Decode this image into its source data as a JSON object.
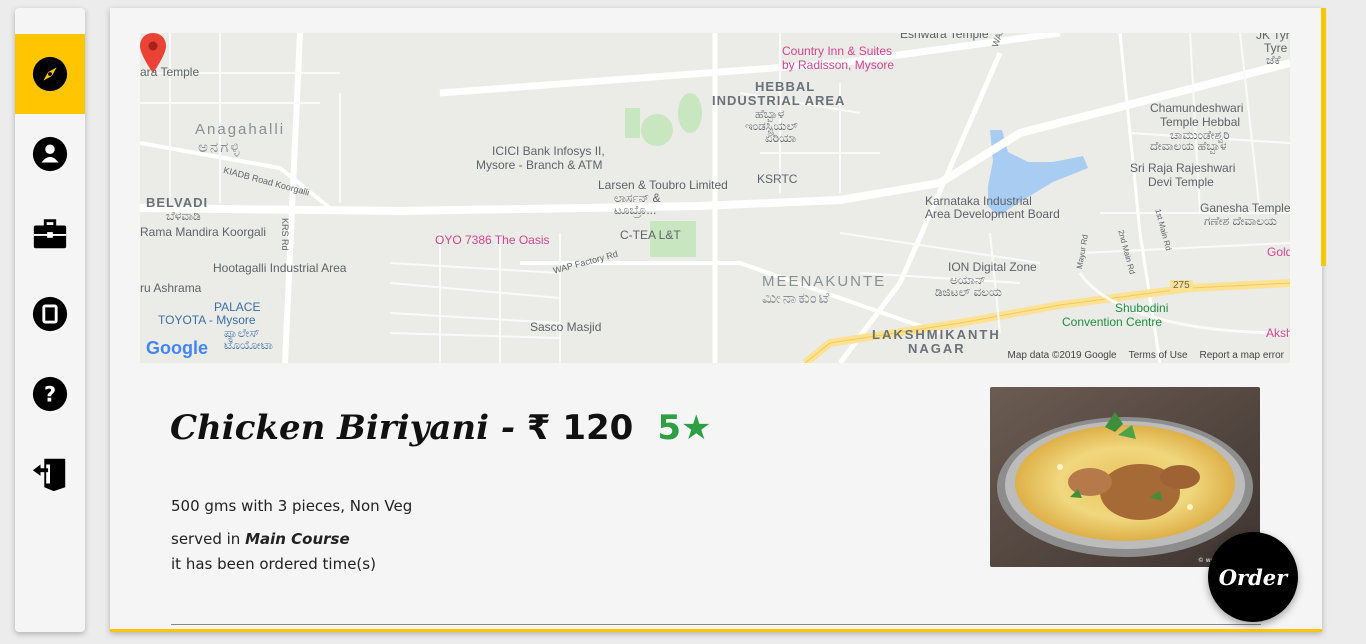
{
  "sidebar": {
    "items": [
      {
        "icon": "compass-icon",
        "active": true
      },
      {
        "icon": "user-icon",
        "active": false
      },
      {
        "icon": "briefcase-icon",
        "active": false
      },
      {
        "icon": "phone-icon",
        "active": false
      },
      {
        "icon": "help-icon",
        "active": false
      },
      {
        "icon": "exit-icon",
        "active": false
      }
    ]
  },
  "map": {
    "labels": {
      "eshwara_temple": "Eshwara Temple",
      "country_inn": "Country Inn & Suites",
      "by_radisson": "by Radisson, Mysore",
      "jk_tyre": "JK Tyre",
      "tyre": "Tyre",
      "tyre_kn": "ಜೆಕೆ",
      "ara_temple": "ara Temple",
      "hebbal": "HEBBAL",
      "industrial_area": "INDUSTRIAL AREA",
      "hebbal_kn": "ಹೆಬ್ಬಾಳ",
      "industrial_kn": "ಇಂಡಸ್ಟ್ರಿಯಲ್",
      "area_kn": "ಏರಿಯಾ",
      "wap_factory_rd": "WAP Factory Rd",
      "chamundeshwari": "Chamundeshwari",
      "temple_hebbal": "Temple Hebbal",
      "chamundeshwari_kn": "ಚಾಮುಂಡೇಶ್ವರಿ",
      "devalaya_kn": "ದೇವಾಲಯ ಹೆಬ್ಬಾಳ",
      "anagahalli": "Anagahalli",
      "anagahalli_kn": "ಅನಗಳ್ಳಿ",
      "icici": "ICICI Bank Infosys II,",
      "icici2": "Mysore - Branch & ATM",
      "sri_raja": "Sri Raja Rajeshwari",
      "devi_temple": "Devi Temple",
      "kiadb": "KIADB Road Koorgalli",
      "larsen": "Larsen & Toubro Limited",
      "larsen_kn1": "ಲಾರ್ಸನ್ &",
      "larsen_kn2": "ಟೂಬ್ರೊ...",
      "ksrtc": "KSRTC",
      "belvadi": "BELVADI",
      "belvadi_kn": "ಬೆಳವಾಡಿ",
      "karnataka_ind": "Karnataka Industrial",
      "area_dev": "Area Development Board",
      "ganesha": "Ganesha Temple",
      "ganesha_kn": "ಗಣೇಶ ದೇವಾಲಯ",
      "rama_mandira": "Rama Mandira Koorgali",
      "krs_rd": "KRS Rd",
      "c_tea": "C-TEA L&T",
      "oyo": "OYO 7386 The Oasis",
      "gold": "Gold",
      "hootagalli": "Hootagalli Industrial Area",
      "wap_factory_rd2": "WAP Factory Rd",
      "meenakunte": "MEENAKUNTE",
      "meenakunte_kn": "ಮೀನಾಕುಂಟೆ",
      "ion": "ION Digital Zone",
      "ion_kn1": "ಅಯಾನ್",
      "ion_kn2": "ಡಿಜಿಟಲ್ ವಲಯ",
      "ru_ashrama": "ru Ashrama",
      "road_275": "275",
      "palace": "PALACE",
      "toyota": "TOYOTA - Mysore",
      "toyota_kn1": "ಪ್ಯಾಲೇಸ್",
      "toyota_kn2": "ಟೊಯೋಟಾ",
      "sasco": "Sasco Masjid",
      "lakshmikanth": "LAKSHMIKANTH",
      "nagar": "NAGAR",
      "shubodini": "Shubodini",
      "convention": "Convention Centre",
      "aksh": "Aksh",
      "mayur_rd": "Mayur Rd",
      "second_main": "2nd Main Rd",
      "first_main": "1st Main Rd"
    },
    "footer": {
      "map_data": "Map data ©2019 Google",
      "terms": "Terms of Use",
      "report": "Report a map error"
    },
    "google_logo": "Google"
  },
  "item": {
    "name": "Chicken Biriyani",
    "separator": " - ",
    "price": "₹ 120",
    "rating": "5★",
    "description": "500 gms with 3 pieces, Non Veg",
    "served_prefix": "served in ",
    "course": "Main Course",
    "ordered_text": "it has been ordered time(s)"
  },
  "image_watermark": "© www.thedeliciou",
  "order_button": "Order",
  "colors": {
    "accent": "#ffc600",
    "rating": "#2ea043",
    "button": "#000000"
  }
}
